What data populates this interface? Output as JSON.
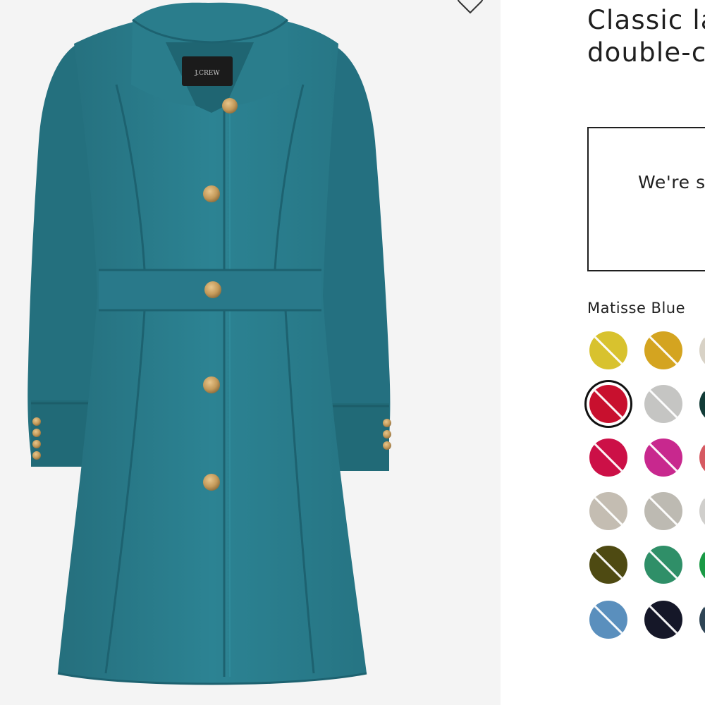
{
  "product": {
    "title_line1": "Classic la",
    "title_line2": "double-c",
    "image": {
      "brand_label": "J.CREW",
      "coat_color": "#2b7f8f"
    }
  },
  "notice": {
    "text": "We're s"
  },
  "color_picker": {
    "selected_label": "Matisse Blue",
    "swatches": [
      {
        "name": "swatch-yellow",
        "color": "#d8c22e"
      },
      {
        "name": "swatch-mustard",
        "color": "#d4a420"
      },
      {
        "name": "swatch-cream",
        "color": "#d8d2c6"
      },
      {
        "name": "swatch-red",
        "color": "#c8102e",
        "selected": true
      },
      {
        "name": "swatch-light-gray",
        "color": "#c5c5c3"
      },
      {
        "name": "swatch-dark-green",
        "color": "#123c37"
      },
      {
        "name": "swatch-crimson",
        "color": "#cc1047"
      },
      {
        "name": "swatch-magenta",
        "color": "#c8288e"
      },
      {
        "name": "swatch-coral",
        "color": "#d65a62"
      },
      {
        "name": "swatch-stone",
        "color": "#c4bdb2"
      },
      {
        "name": "swatch-taupe",
        "color": "#bdbab2"
      },
      {
        "name": "swatch-pale-gray",
        "color": "#d0cfcc"
      },
      {
        "name": "swatch-olive",
        "color": "#4e4a12"
      },
      {
        "name": "swatch-emerald",
        "color": "#2f8f68"
      },
      {
        "name": "swatch-kelly-green",
        "color": "#199a45"
      },
      {
        "name": "swatch-steel-blue",
        "color": "#5a8fbd"
      },
      {
        "name": "swatch-navy",
        "color": "#151728"
      },
      {
        "name": "swatch-slate",
        "color": "#2f4555"
      }
    ]
  },
  "icons": {
    "wishlist": "heart-outline-icon"
  }
}
